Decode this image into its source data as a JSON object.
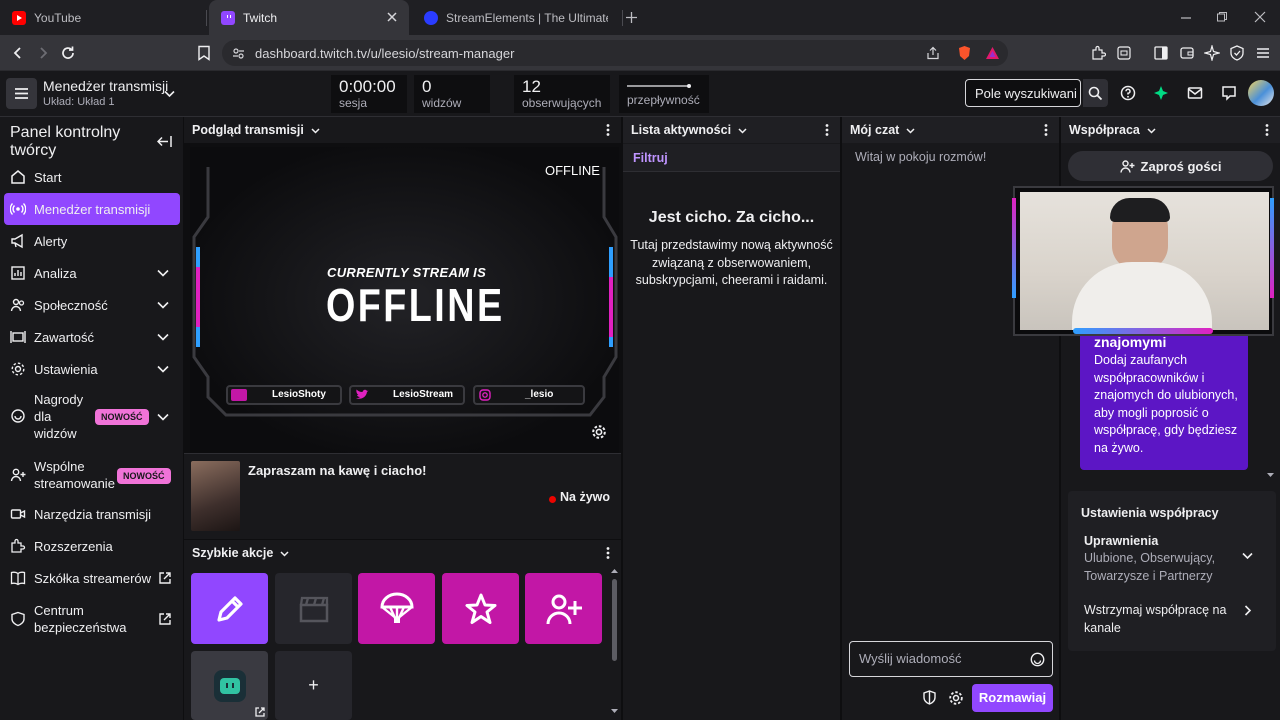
{
  "browser": {
    "tabs": [
      {
        "title": "YouTube"
      },
      {
        "title": "Twitch"
      },
      {
        "title": "StreamElements | The Ultimate Strear"
      }
    ],
    "url": "dashboard.twitch.tv/u/leesio/stream-manager"
  },
  "topnav": {
    "title": "Menedżer transmisji",
    "subtitle": "Układ: Układ 1",
    "stats": [
      {
        "value": "0:00:00",
        "label": "sesja"
      },
      {
        "value": "0",
        "label": "widzów"
      },
      {
        "value": "12",
        "label": "obserwujących"
      },
      {
        "value": "",
        "label": "przepływność"
      }
    ],
    "search_placeholder": "Pole wyszukiwani"
  },
  "sidebar": {
    "title": "Panel kontrolny twórcy",
    "new_badge": "NOWOŚĆ",
    "items": [
      {
        "label": "Start"
      },
      {
        "label": "Menedżer transmisji"
      },
      {
        "label": "Alerty"
      },
      {
        "label": "Analiza"
      },
      {
        "label": "Społeczność"
      },
      {
        "label": "Zawartość"
      },
      {
        "label": "Ustawienia"
      },
      {
        "label": "Nagrody dla widzów"
      },
      {
        "label": "Wspólne streamowanie"
      },
      {
        "label": "Narzędzia transmisji"
      },
      {
        "label": "Rozszerzenia"
      },
      {
        "label": "Szkółka streamerów"
      },
      {
        "label": "Centrum bezpieczeństwa"
      }
    ]
  },
  "preview": {
    "header": "Podgląd transmisji",
    "offline_badge": "OFFLINE",
    "overlay_line1": "CURRENTLY STREAM IS",
    "overlay_line2": "OFFLINE",
    "socials": [
      "LesioShoty",
      "LesioStream",
      "_lesio"
    ],
    "stream_title": "Zapraszam na kawę i ciacho!",
    "live_label": "Na żywo"
  },
  "quick_actions": {
    "header": "Szybkie akcje",
    "add_label": "+"
  },
  "activity": {
    "header": "Lista aktywności",
    "filter_label": "Filtruj",
    "empty_title": "Jest cicho. Za cicho...",
    "empty_body": "Tutaj przedstawimy nową aktywność związaną z obserwowaniem, subskrypcjami, cheerami i raidami."
  },
  "chat": {
    "header": "Mój czat",
    "welcome": "Witaj w pokoju rozmów!",
    "input_placeholder": "Wyślij wiadomość",
    "send_label": "Rozmawiaj"
  },
  "collab": {
    "header": "Współpraca",
    "invite_label": "Zaproś gości",
    "promo_title": "znajomymi",
    "promo_body": "Dodaj zaufanych współpracowników i znajomych do ulubionych, aby mogli poprosić o współpracę, gdy będziesz na żywo.",
    "settings_title": "Ustawienia współpracy",
    "permissions_label": "Uprawnienia",
    "permissions_value": "Ulubione, Obserwujący, Towarzysze i Partnerzy",
    "pause_label": "Wstrzymaj współpracę na kanale"
  },
  "colors": {
    "accent": "#9147ff",
    "magenta": "#c217a6",
    "live": "#eb0400"
  }
}
